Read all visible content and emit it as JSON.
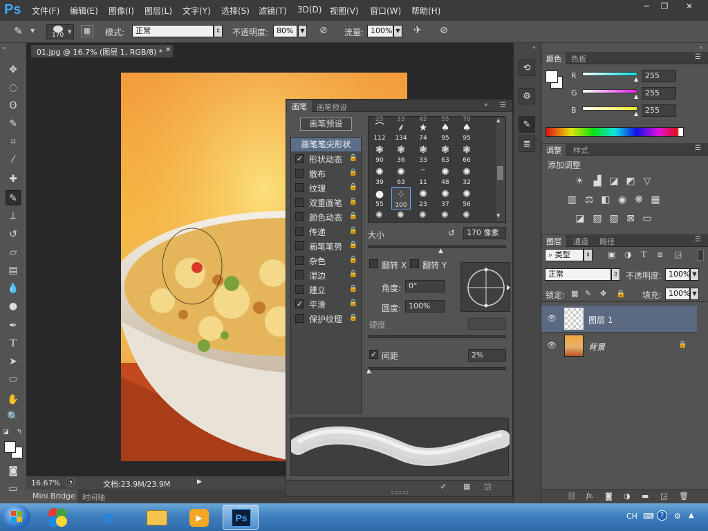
{
  "app": {
    "logo": "Ps"
  },
  "menu": [
    "文件(F)",
    "编辑(E)",
    "图像(I)",
    "图层(L)",
    "文字(Y)",
    "选择(S)",
    "滤镜(T)",
    "3D(D)",
    "视图(V)",
    "窗口(W)",
    "帮助(H)"
  ],
  "options": {
    "brush_size": "170",
    "mode_label": "模式:",
    "mode_value": "正常",
    "opacity_label": "不透明度:",
    "opacity_value": "80%",
    "flow_label": "流量:",
    "flow_value": "100%"
  },
  "document": {
    "tab_title": "01.jpg @ 16.7% (图层 1, RGB/8) *",
    "zoom": "16.67%",
    "doc_info": "文档:23.9M/23.9M"
  },
  "bottom_tabs": [
    "Mini Bridge",
    "时间轴"
  ],
  "brush_panel": {
    "tabs": [
      "画笔",
      "画笔预设"
    ],
    "preset_button": "画笔预设",
    "tip_shape_header": "画笔笔尖形状",
    "options": [
      {
        "label": "形状动态",
        "checked": true
      },
      {
        "label": "散布",
        "checked": false
      },
      {
        "label": "纹理",
        "checked": false
      },
      {
        "label": "双重画笔",
        "checked": false
      },
      {
        "label": "颜色动态",
        "checked": false
      },
      {
        "label": "传递",
        "checked": false
      },
      {
        "label": "画笔笔势",
        "checked": false
      },
      {
        "label": "杂色",
        "checked": false
      },
      {
        "label": "湿边",
        "checked": false
      },
      {
        "label": "建立",
        "checked": false
      },
      {
        "label": "平滑",
        "checked": true
      },
      {
        "label": "保护纹理",
        "checked": false
      }
    ],
    "tip_rows": [
      [
        "112",
        "134",
        "74",
        "95",
        "95"
      ],
      [
        "90",
        "36",
        "33",
        "63",
        "66"
      ],
      [
        "39",
        "63",
        "11",
        "48",
        "32"
      ],
      [
        "55",
        "100",
        "23",
        "37",
        "56"
      ]
    ],
    "top_row_partial": [
      "25",
      "33",
      "42",
      "55",
      "70"
    ],
    "selected_tip": "100",
    "size_label": "大小",
    "size_value": "170 像素",
    "size_fraction": 0.53,
    "flip_x_label": "翻转 X",
    "flip_y_label": "翻转 Y",
    "angle_label": "角度:",
    "angle_value": "0°",
    "roundness_label": "圆度:",
    "roundness_value": "100%",
    "hardness_label": "硬度",
    "spacing_label": "间距",
    "spacing_checked": true,
    "spacing_value": "2%",
    "spacing_fraction": 0.01
  },
  "color_panel": {
    "tabs": [
      "颜色",
      "色板"
    ],
    "channels": [
      {
        "label": "R",
        "value": "255",
        "color": "#00e0e0"
      },
      {
        "label": "G",
        "value": "255",
        "color": "#e020e0"
      },
      {
        "label": "B",
        "value": "255",
        "color": "#f0f020"
      }
    ]
  },
  "adjust_panel": {
    "tabs": [
      "调整",
      "样式"
    ],
    "title": "添加调整"
  },
  "layers_panel": {
    "tabs": [
      "图层",
      "通道",
      "路径"
    ],
    "filter_value": "类型",
    "blend_value": "正常",
    "opacity_label": "不透明度:",
    "opacity_value": "100%",
    "lock_label": "锁定:",
    "fill_label": "填充:",
    "fill_value": "100%",
    "layers": [
      {
        "name": "图层 1",
        "selected": true
      },
      {
        "name": "背景",
        "selected": false
      }
    ]
  },
  "taskbar": {
    "lang": "CH"
  }
}
